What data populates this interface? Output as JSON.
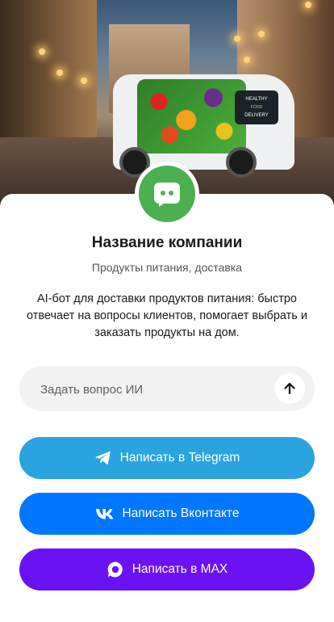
{
  "hero": {
    "image_description": "",
    "van_sign": [
      "HEALTHY",
      "FOOD",
      "DELIVERY"
    ]
  },
  "company": {
    "name": "Название компании",
    "subtitle": "Продукты питания, доставка",
    "description": "AI-бот для доставки продуктов питания: быстро отвечает на вопросы клиентов, помогает выбрать и заказать продукты на дом.",
    "avatar_icon": "chat-bot-icon",
    "avatar_color": "#4caf50"
  },
  "ask": {
    "placeholder": "Задать вопрос ИИ",
    "send_icon": "arrow-up-icon"
  },
  "buttons": {
    "telegram": {
      "label": "Написать в Telegram",
      "icon": "telegram-icon",
      "color": "#2aa3df"
    },
    "vk": {
      "label": "Написать Вконтакте",
      "icon": "vk-icon",
      "color": "#0077ff"
    },
    "max": {
      "label": "Написать в MAX",
      "icon": "max-icon",
      "color": "#6a12f4"
    }
  }
}
